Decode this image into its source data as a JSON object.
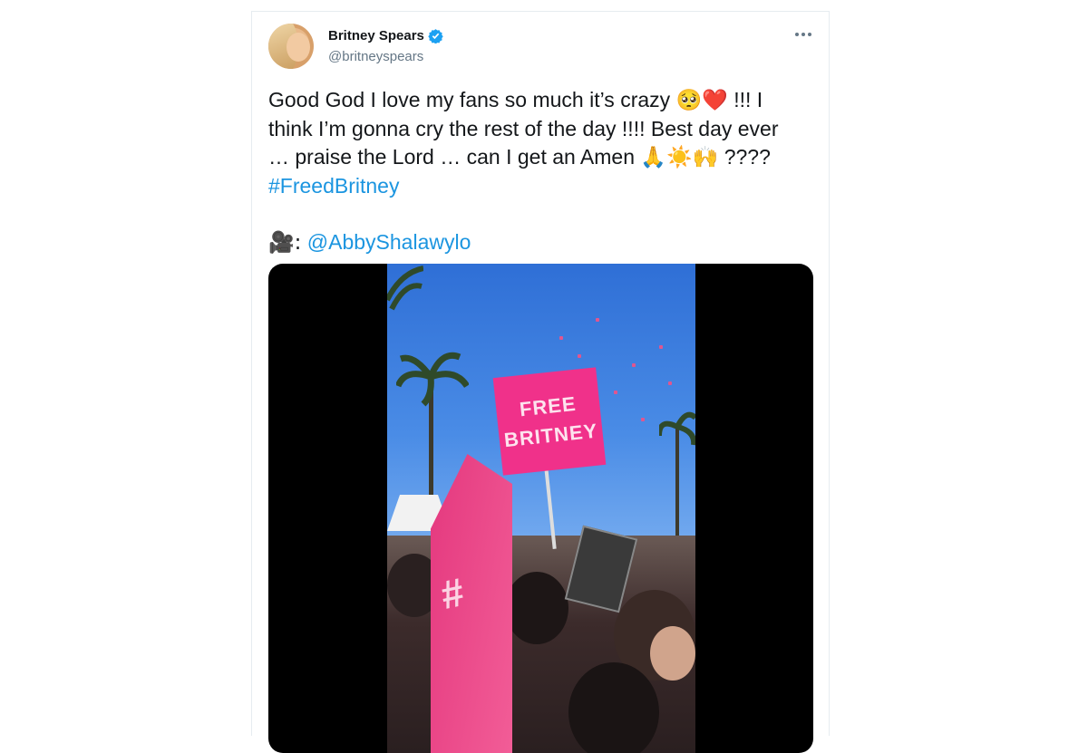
{
  "tweet": {
    "author_name": "Britney Spears",
    "handle": "@britneyspears",
    "verified": true,
    "text_lines": [
      "Good God I love my fans so much it’s crazy",
      "!!! I",
      "think I’m gonna cry the rest of the day !!!! Best day ever",
      "… praise the Lord … can I get an Amen",
      "????"
    ],
    "emoji_1": "🥺❤️",
    "emoji_2": "🙏☀️🙌",
    "hashtag": "#FreedBritney",
    "credit_prefix": "🎥:",
    "credit_mention": "@AbbyShalawylo",
    "media": {
      "sign_line_1": "FREE",
      "sign_line_2": "BRITNEY",
      "flag_symbol": "#"
    }
  },
  "colors": {
    "link": "#1b95e0",
    "verified": "#1da1f2",
    "text": "#14171a",
    "secondary": "#657786",
    "sign": "#f0318a"
  },
  "icons": {
    "verified": "verified-badge-icon",
    "more": "more-options-icon"
  }
}
